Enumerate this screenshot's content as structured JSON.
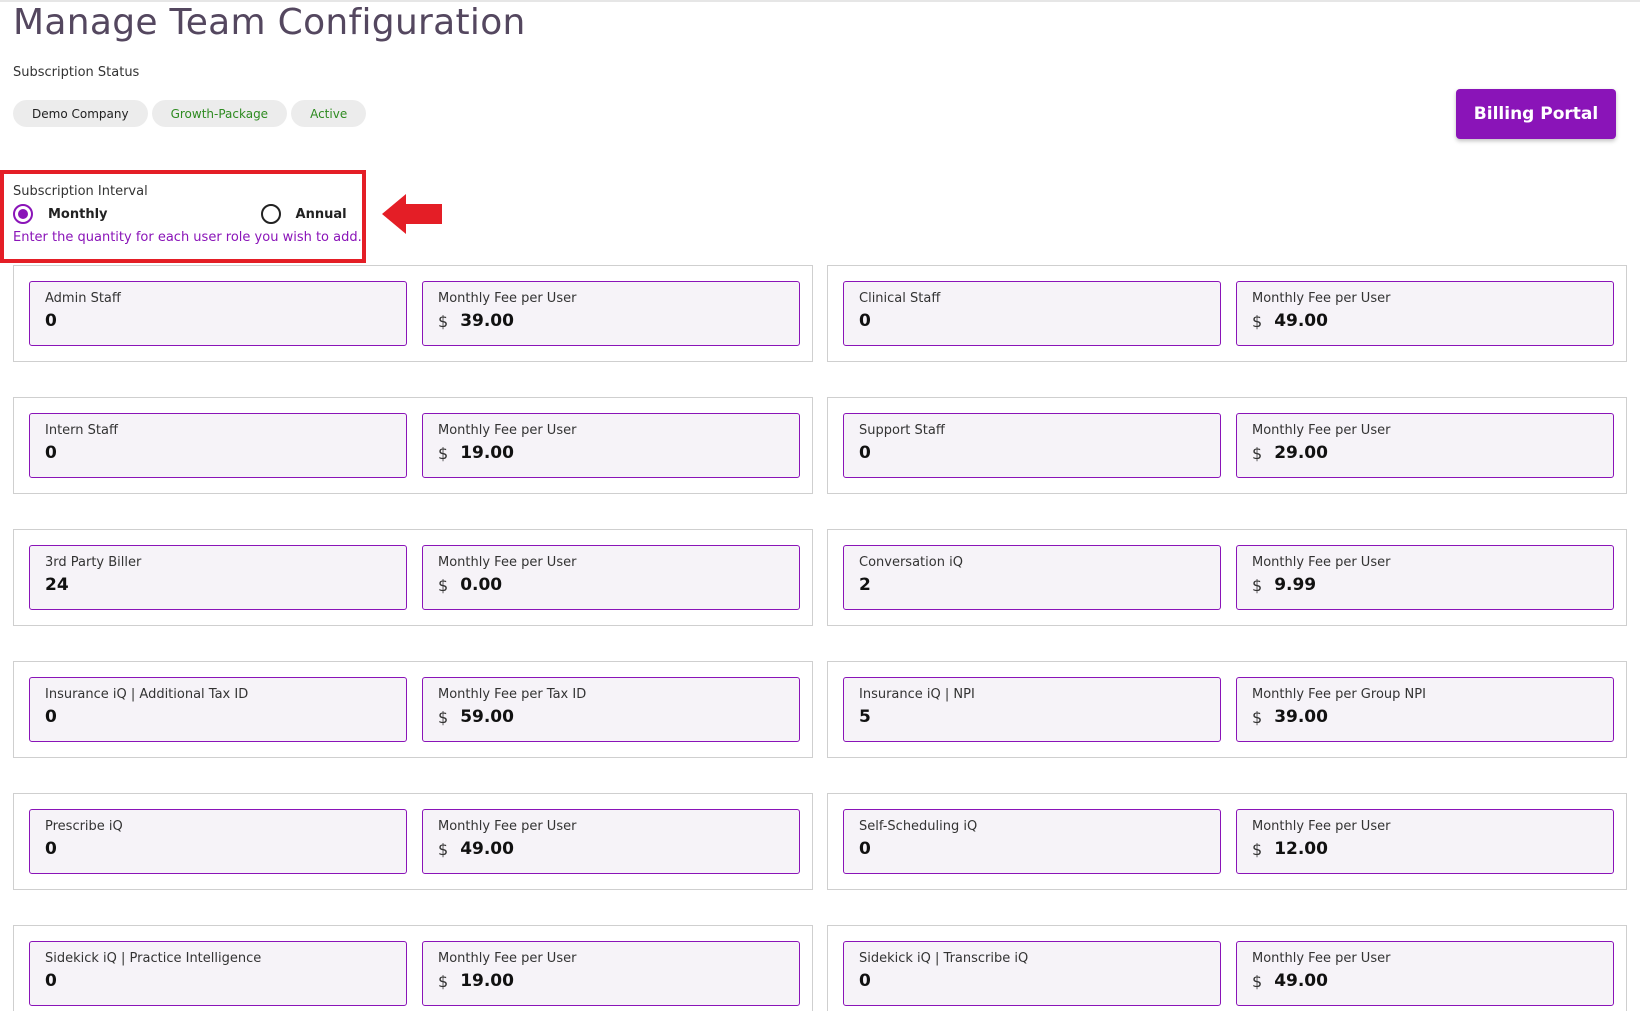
{
  "page": {
    "title": "Manage Team Configuration",
    "subscription_status_label": "Subscription Status"
  },
  "status_chips": {
    "company": "Demo Company",
    "package": "Growth-Package",
    "state": "Active"
  },
  "billing_button": "Billing Portal",
  "interval": {
    "label": "Subscription Interval",
    "options": [
      "Monthly",
      "Annual"
    ],
    "selected": "Monthly",
    "hint": "Enter the quantity for each user role you wish to add."
  },
  "currency_symbol": "$",
  "roles": [
    {
      "name": "Admin Staff",
      "quantity": "0",
      "fee_label": "Monthly Fee per User",
      "fee": "39.00"
    },
    {
      "name": "Clinical Staff",
      "quantity": "0",
      "fee_label": "Monthly Fee per User",
      "fee": "49.00"
    },
    {
      "name": "Intern Staff",
      "quantity": "0",
      "fee_label": "Monthly Fee per User",
      "fee": "19.00"
    },
    {
      "name": "Support Staff",
      "quantity": "0",
      "fee_label": "Monthly Fee per User",
      "fee": "29.00"
    },
    {
      "name": "3rd Party Biller",
      "quantity": "24",
      "fee_label": "Monthly Fee per User",
      "fee": "0.00"
    },
    {
      "name": "Conversation iQ",
      "quantity": "2",
      "fee_label": "Monthly Fee per User",
      "fee": "9.99"
    },
    {
      "name": "Insurance iQ | Additional Tax ID",
      "quantity": "0",
      "fee_label": "Monthly Fee per Tax ID",
      "fee": "59.00"
    },
    {
      "name": "Insurance iQ | NPI",
      "quantity": "5",
      "fee_label": "Monthly Fee per Group NPI",
      "fee": "39.00"
    },
    {
      "name": "Prescribe iQ",
      "quantity": "0",
      "fee_label": "Monthly Fee per User",
      "fee": "49.00"
    },
    {
      "name": "Self-Scheduling iQ",
      "quantity": "0",
      "fee_label": "Monthly Fee per User",
      "fee": "12.00"
    },
    {
      "name": "Sidekick iQ | Practice Intelligence",
      "quantity": "0",
      "fee_label": "Monthly Fee per User",
      "fee": "19.00"
    },
    {
      "name": "Sidekick iQ | Transcribe iQ",
      "quantity": "0",
      "fee_label": "Monthly Fee per User",
      "fee": "49.00"
    }
  ],
  "colors": {
    "accent": "#8a14b8",
    "highlight_box": "#e41e26",
    "chip_green_text": "#2e8b20"
  }
}
